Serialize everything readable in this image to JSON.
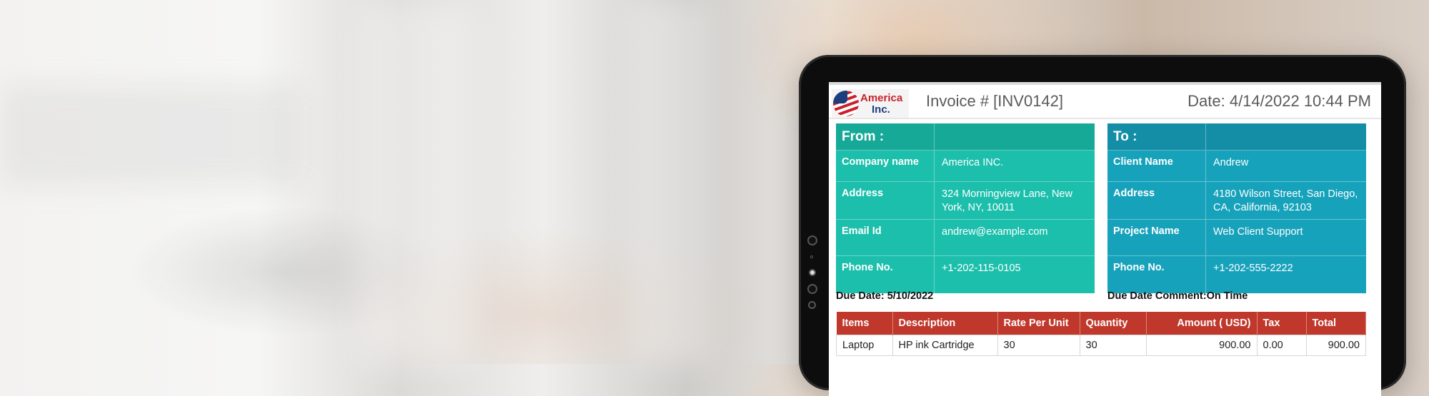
{
  "logo": {
    "line1": "America",
    "line2": "Inc."
  },
  "invoice": {
    "number": "Invoice # [INV0142]",
    "date": "Date: 4/14/2022 10:44 PM"
  },
  "from": {
    "title": "From :",
    "rows": [
      {
        "label": "Company name",
        "value": "America INC."
      },
      {
        "label": "Address",
        "value": "324 Morningview Lane, New York, NY, 10011"
      },
      {
        "label": "Email Id",
        "value": "andrew@example.com"
      },
      {
        "label": "Phone No.",
        "value": "+1-202-115-0105"
      }
    ]
  },
  "to": {
    "title": "To :",
    "rows": [
      {
        "label": "Client Name",
        "value": "Andrew"
      },
      {
        "label": "Address",
        "value": "4180 Wilson Street, San Diego, CA, California, 92103"
      },
      {
        "label": "Project Name",
        "value": "Web Client Support"
      },
      {
        "label": "Phone No.",
        "value": "+1-202-555-2222"
      }
    ]
  },
  "due": {
    "date": "Due Date: 5/10/2022",
    "comment_label": "Due Date Comment:",
    "comment_value": "On Time"
  },
  "table": {
    "headers": [
      "Items",
      "Description",
      "Rate Per Unit",
      "Quantity",
      "Amount ( USD)",
      "Tax",
      "Total"
    ],
    "rows": [
      [
        "Laptop",
        "HP ink Cartridge",
        "30",
        "30",
        "900.00",
        "0.00",
        "900.00"
      ]
    ]
  },
  "colors": {
    "from_panel": "#1cbfab",
    "to_panel": "#17a2bb",
    "table_header": "#c0382b"
  }
}
